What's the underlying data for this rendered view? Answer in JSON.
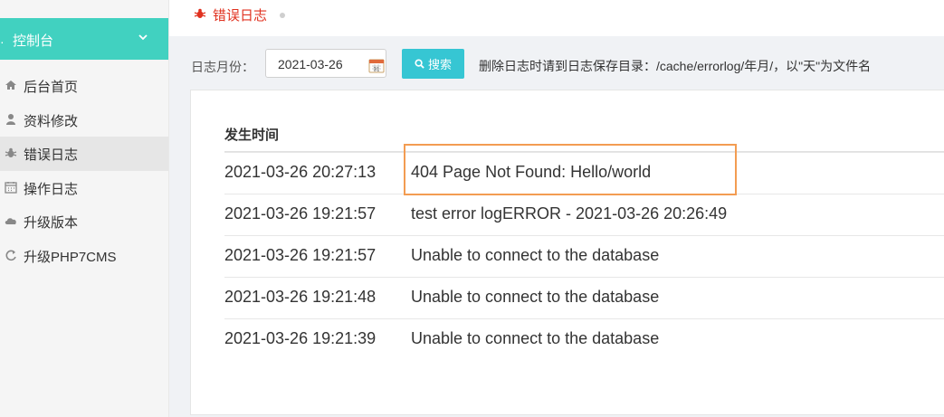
{
  "sidebar": {
    "header": {
      "label": "控制台",
      "dot": "·",
      "icon": "chevron-down-icon"
    },
    "items": [
      {
        "label": "后台首页",
        "icon": "home-icon"
      },
      {
        "label": "资料修改",
        "icon": "user-icon"
      },
      {
        "label": "错误日志",
        "icon": "bug-icon",
        "active": true
      },
      {
        "label": "操作日志",
        "icon": "calendar-icon"
      },
      {
        "label": "升级版本",
        "icon": "cloud-icon"
      },
      {
        "label": "升级PHP7CMS",
        "icon": "refresh-icon"
      }
    ]
  },
  "topbar": {
    "title": "错误日志",
    "icon": "bug-icon"
  },
  "search": {
    "month_label": "日志月份：",
    "date_value": "2021-03-26",
    "button_label": "搜索",
    "hint": "删除日志时请到日志保存目录：/cache/errorlog/年月/，以\"天\"为文件名"
  },
  "table": {
    "header_time": "发生时间",
    "rows": [
      {
        "time": "2021-03-26 20:27:13",
        "message": "404 Page Not Found: Hello/world"
      },
      {
        "time": "2021-03-26 19:21:57",
        "message": "test error logERROR - 2021-03-26 20:26:49"
      },
      {
        "time": "2021-03-26 19:21:57",
        "message": "Unable to connect to the database"
      },
      {
        "time": "2021-03-26 19:21:48",
        "message": "Unable to connect to the database"
      },
      {
        "time": "2021-03-26 19:21:39",
        "message": "Unable to connect to the database"
      }
    ]
  },
  "colors": {
    "accent": "#41d1c0",
    "button": "#36c6d3",
    "title_red": "#e0311f",
    "highlight": "#f39c52"
  }
}
